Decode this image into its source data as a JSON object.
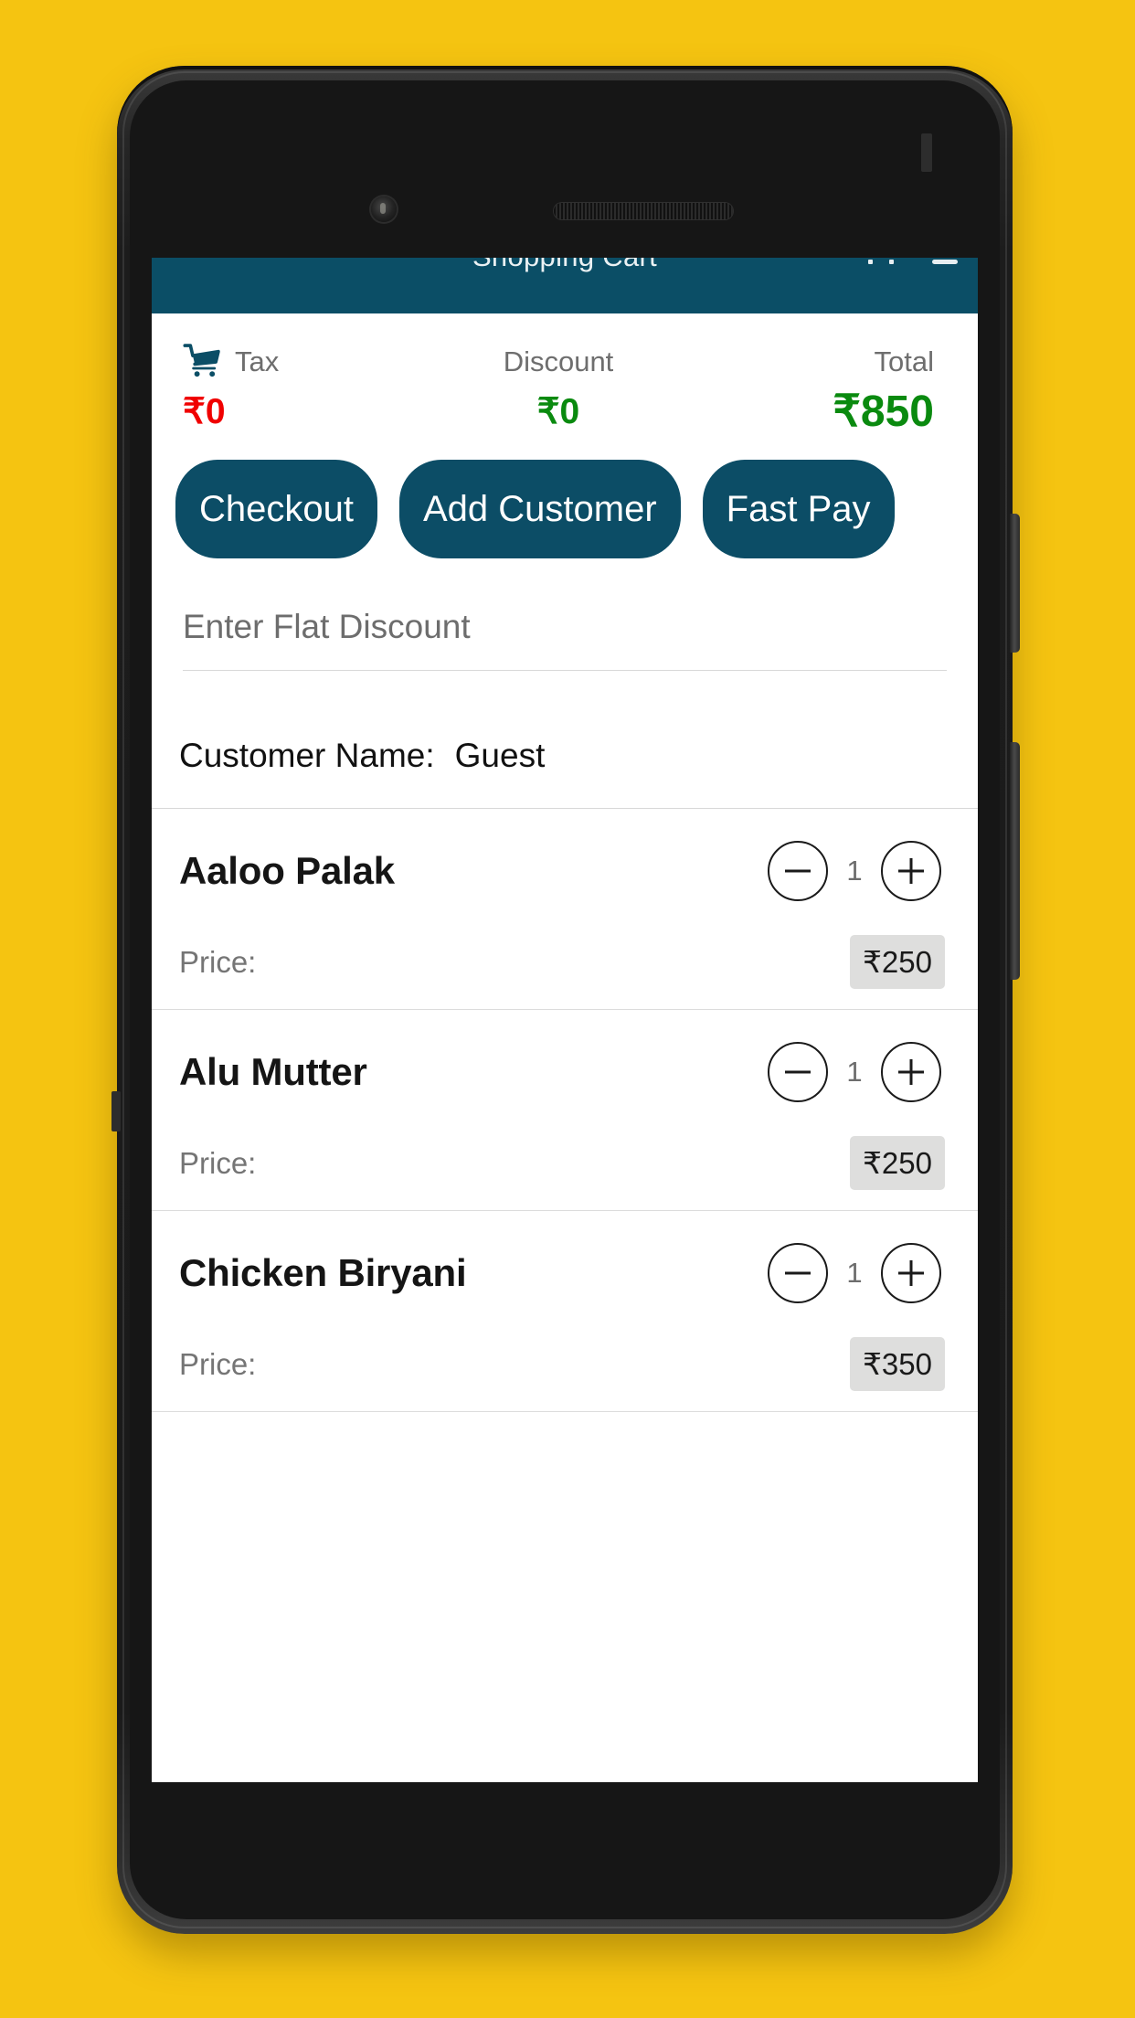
{
  "background_color": "#F5C411",
  "device": {
    "frame_color": "#1a1a1a",
    "camera_icon": "front-camera-icon",
    "speaker_icon": "earpiece-speaker-icon"
  },
  "app": {
    "accent_color": "#0B4E66",
    "app_bar_title": "Shopping Cart"
  },
  "status_bar": {
    "battery_icon": "battery-icon",
    "signal_icon": "signal-icon"
  },
  "summary": {
    "cart_icon": "shopping-cart-icon",
    "cells": [
      {
        "label": "Tax",
        "value": "₹0",
        "color": "#f00000"
      },
      {
        "label": "Discount",
        "value": "₹0",
        "color": "#0a8a0f"
      },
      {
        "label": "Total",
        "value": "₹850",
        "color": "#0a8a0f"
      }
    ]
  },
  "actions": {
    "checkout_label": "Checkout",
    "add_customer_label": "Add Customer",
    "fast_pay_label": "Fast Pay"
  },
  "discount": {
    "placeholder": "Enter Flat Discount",
    "value": ""
  },
  "customer": {
    "label": "Customer Name:",
    "name": "Guest"
  },
  "cart": {
    "price_label": "Price:",
    "decrement_icon": "minus-circle-icon",
    "increment_icon": "plus-circle-icon",
    "items": [
      {
        "name": "Aaloo Palak",
        "qty": "1",
        "price": "₹250"
      },
      {
        "name": "Alu Mutter",
        "qty": "1",
        "price": "₹250"
      },
      {
        "name": "Chicken Biryani",
        "qty": "1",
        "price": "₹350"
      }
    ]
  }
}
